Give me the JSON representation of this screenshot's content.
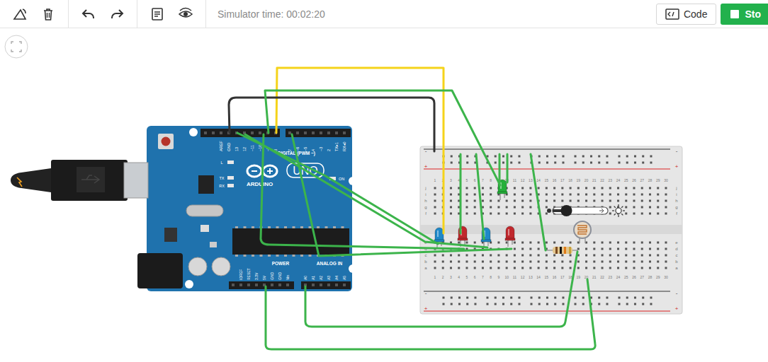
{
  "toolbar": {
    "simulator_time": "Simulator time: 00:02:20",
    "code_button": "Code",
    "stop_button": "Sto"
  },
  "arduino": {
    "digital_pins": [
      "AREF",
      "GND",
      "13",
      "12",
      "~11",
      "~10",
      "~9",
      "8",
      "7",
      "~6",
      "~5",
      "4",
      "~3",
      "2",
      "TX▸1",
      "RX◂0"
    ],
    "digital_label": "DIGITAL (PWM ~)",
    "brand": "ARDUINO",
    "model": "UNO",
    "led_labels": [
      "L",
      "TX",
      "RX"
    ],
    "on_label": "ON",
    "power_label": "POWER",
    "analog_label": "ANALOG IN",
    "power_pins": [
      "IOREF",
      "RESET",
      "3.3V",
      "5V",
      "GND",
      "GND",
      "Vin"
    ],
    "analog_pins": [
      "A0",
      "A1",
      "A2",
      "A3",
      "A4",
      "A5"
    ]
  },
  "breadboard": {
    "columns": [
      "1",
      "2",
      "3",
      "4",
      "5",
      "6",
      "7",
      "8",
      "9",
      "10",
      "11",
      "12",
      "13",
      "14",
      "15",
      "16",
      "17",
      "18",
      "19",
      "20",
      "21",
      "22",
      "23",
      "24",
      "25",
      "26",
      "27",
      "28",
      "29",
      "30"
    ],
    "rows": [
      "j",
      "i",
      "h",
      "g",
      "f",
      "e",
      "d",
      "c",
      "b",
      "a"
    ],
    "rail_signs": [
      "-",
      "+"
    ]
  },
  "leds": [
    {
      "color": "#1e88c8"
    },
    {
      "color": "#c0282d"
    },
    {
      "color": "#1e88c8"
    },
    {
      "color": "#c0282d"
    },
    {
      "color": "#25b03a"
    }
  ],
  "light_sensor": {
    "level": 0.25
  },
  "wires": [
    {
      "color": "#f5d31a"
    },
    {
      "color": "#333333"
    },
    {
      "color": "#3cb44b"
    },
    {
      "color": "#3cb44b"
    },
    {
      "color": "#3cb44b"
    },
    {
      "color": "#3cb44b"
    },
    {
      "color": "#3cb44b"
    },
    {
      "color": "#3cb44b"
    },
    {
      "color": "#3cb44b"
    },
    {
      "color": "#3cb44b"
    },
    {
      "color": "#3cb44b"
    },
    {
      "color": "#3cb44b"
    },
    {
      "color": "#3cb44b"
    },
    {
      "color": "#3cb44b"
    }
  ]
}
